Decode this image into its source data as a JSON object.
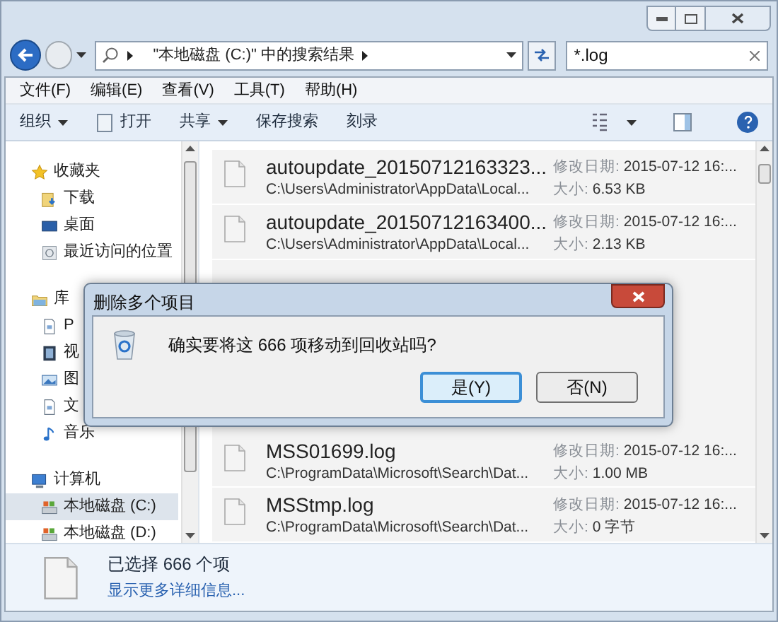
{
  "address_bar": {
    "path": "\"本地磁盘 (C:)\" 中的搜索结果"
  },
  "search": {
    "value": "*.log"
  },
  "menu": [
    "文件(F)",
    "编辑(E)",
    "查看(V)",
    "工具(T)",
    "帮助(H)"
  ],
  "toolbar": [
    {
      "label": "组织",
      "kind": "dropdown"
    },
    {
      "label": "打开",
      "kind": "open"
    },
    {
      "label": "共享",
      "kind": "dropdown"
    },
    {
      "label": "保存搜索",
      "kind": "plain"
    },
    {
      "label": "刻录",
      "kind": "plain"
    }
  ],
  "sidebar": [
    {
      "label": "收藏夹",
      "kind": "star",
      "selected": false,
      "children": [
        {
          "label": "下载",
          "kind": "download",
          "selected": false
        },
        {
          "label": "桌面",
          "kind": "desktop",
          "selected": false
        },
        {
          "label": "最近访问的位置",
          "kind": "recent",
          "selected": false
        }
      ]
    },
    {
      "label": "库",
      "kind": "library",
      "selected": false,
      "children": [
        {
          "label": "P",
          "kind": "document",
          "selected": false
        },
        {
          "label": "视",
          "kind": "video",
          "selected": false
        },
        {
          "label": "图",
          "kind": "picture",
          "selected": false
        },
        {
          "label": "文",
          "kind": "document",
          "selected": false
        },
        {
          "label": "音乐",
          "kind": "music",
          "selected": false
        }
      ]
    },
    {
      "label": "计算机",
      "kind": "computer",
      "selected": false,
      "children": [
        {
          "label": "本地磁盘 (C:)",
          "kind": "drive",
          "selected": true
        },
        {
          "label": "本地磁盘 (D:)",
          "kind": "drive",
          "selected": false
        }
      ]
    }
  ],
  "file_list_top": [
    {
      "name": "autoupdate_20150712163323...",
      "path": "C:\\Users\\Administrator\\AppData\\Local...",
      "date_label": "修改日期:",
      "date": "2015-07-12 16:...",
      "size_label": "大小:",
      "size": "6.53 KB"
    },
    {
      "name": "autoupdate_20150712163400...",
      "path": "C:\\Users\\Administrator\\AppData\\Local...",
      "date_label": "修改日期:",
      "date": "2015-07-12 16:...",
      "size_label": "大小:",
      "size": "2.13 KB"
    }
  ],
  "file_list_bottom": [
    {
      "name": "MSS01699.log",
      "path": "C:\\ProgramData\\Microsoft\\Search\\Dat...",
      "date_label": "修改日期:",
      "date": "2015-07-12 16:...",
      "size_label": "大小:",
      "size": "1.00 MB"
    },
    {
      "name": "MSStmp.log",
      "path": "C:\\ProgramData\\Microsoft\\Search\\Dat...",
      "date_label": "修改日期:",
      "date": "2015-07-12 16:...",
      "size_label": "大小:",
      "size": "0 字节"
    }
  ],
  "dialog": {
    "title": "删除多个项目",
    "message": "确实要将这 666 项移动到回收站吗?",
    "buttons": [
      {
        "label": "是(Y)",
        "selected": true
      },
      {
        "label": "否(N)",
        "selected": false
      }
    ]
  },
  "status_bar": {
    "selection": "已选择 666 个项",
    "details_link": "显示更多详细信息..."
  }
}
